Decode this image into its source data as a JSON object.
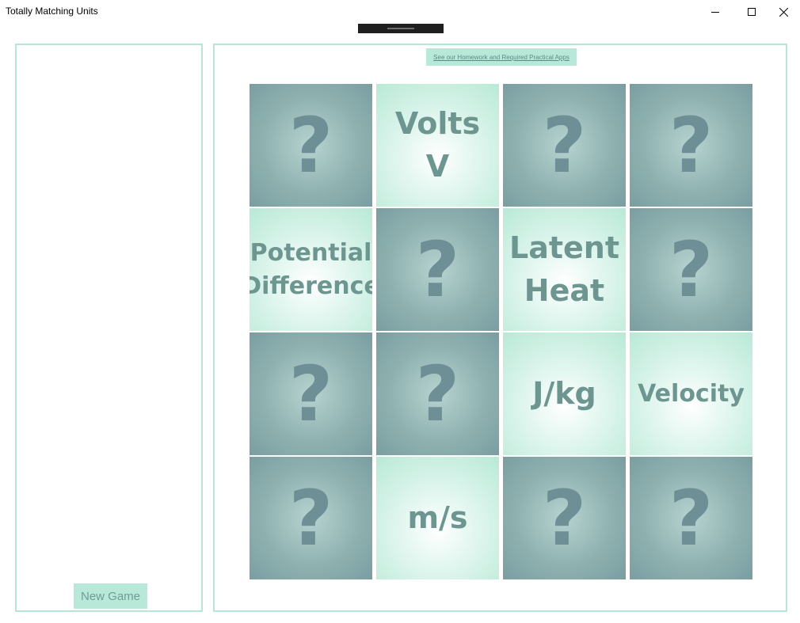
{
  "window": {
    "title": "Totally Matching Units",
    "icons": {
      "minimize": "minimize-icon",
      "maximize": "maximize-icon",
      "close": "close-icon"
    }
  },
  "sidebar": {
    "new_game_label": "New Game"
  },
  "main": {
    "apps_link_label": "See our Homework and Required Practical Apps"
  },
  "colors": {
    "panel_border": "#b8e6d6",
    "button_bg": "#b8e9d8",
    "card_hidden": "#8fb2b0",
    "card_revealed": "#e1f6ef",
    "card_text": "#6e9691"
  },
  "cards": [
    {
      "state": "hidden",
      "text": "?"
    },
    {
      "state": "revealed",
      "line1": "Volts",
      "line2": "V"
    },
    {
      "state": "hidden",
      "text": "?"
    },
    {
      "state": "hidden",
      "text": "?"
    },
    {
      "state": "revealed",
      "line1": "Potential",
      "line2": "Difference"
    },
    {
      "state": "hidden",
      "text": "?"
    },
    {
      "state": "revealed",
      "line1": "Latent",
      "line2": "Heat"
    },
    {
      "state": "hidden",
      "text": "?"
    },
    {
      "state": "hidden",
      "text": "?"
    },
    {
      "state": "hidden",
      "text": "?"
    },
    {
      "state": "revealed",
      "line1": "J/kg",
      "line2": ""
    },
    {
      "state": "revealed",
      "line1": "Velocity",
      "line2": ""
    },
    {
      "state": "hidden",
      "text": "?"
    },
    {
      "state": "revealed",
      "line1": "m/s",
      "line2": ""
    },
    {
      "state": "hidden",
      "text": "?"
    },
    {
      "state": "hidden",
      "text": "?"
    }
  ]
}
